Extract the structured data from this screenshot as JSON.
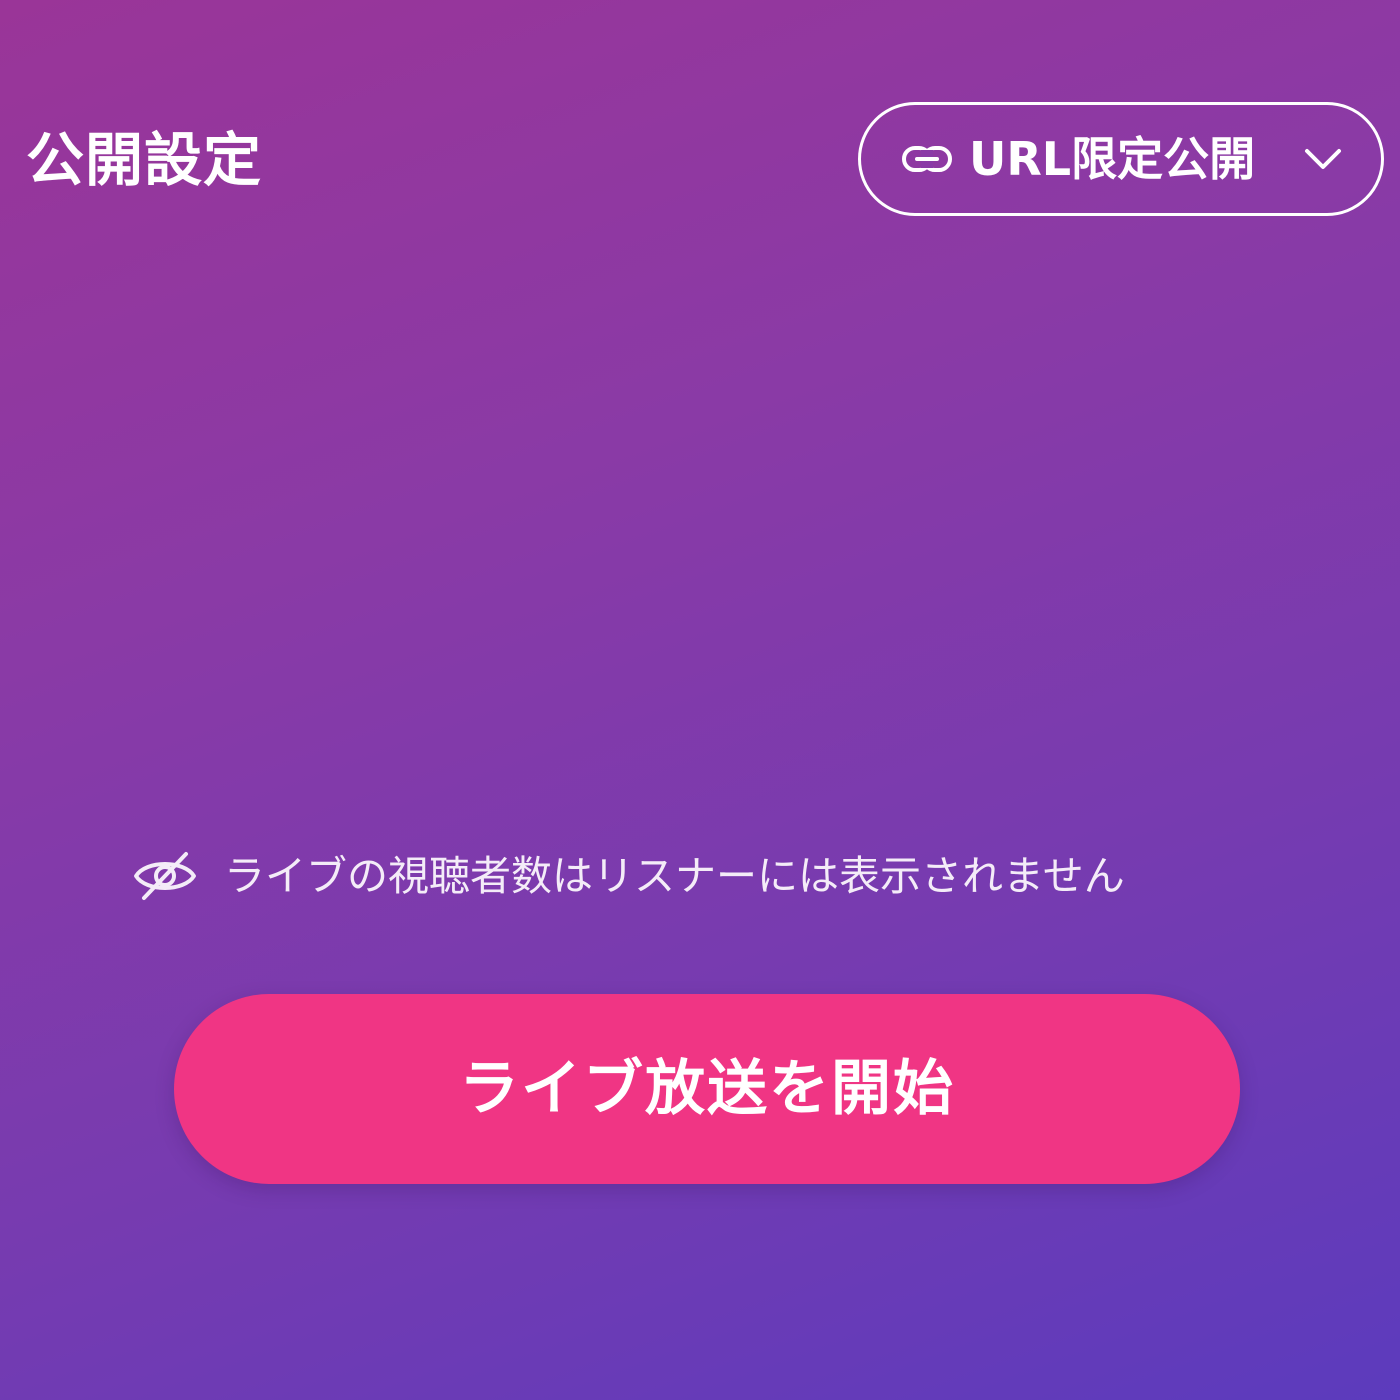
{
  "header": {
    "title": "公開設定"
  },
  "visibility": {
    "selected": "URL限定公開",
    "icon": "link-icon",
    "dropdown_icon": "chevron-down-icon"
  },
  "notice": {
    "icon": "eye-off-icon",
    "text": "ライブの視聴者数はリスナーには表示されません"
  },
  "start_button": {
    "label": "ライブ放送を開始"
  },
  "colors": {
    "background_top": "#9a3598",
    "background_bottom": "#5c3bbd",
    "button": "#f03584",
    "text": "#ffffff"
  }
}
